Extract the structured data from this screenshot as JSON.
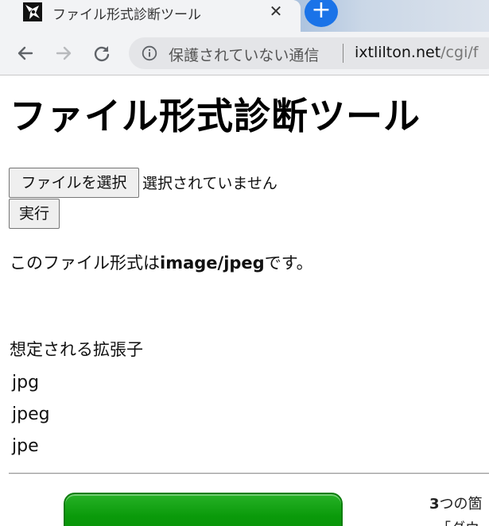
{
  "browser": {
    "tab_title": "ファイル形式診断ツール",
    "tab_close": "✕",
    "new_tab": "+",
    "security_label": "保護されていない通信",
    "url_host": "ixtlilton.net",
    "url_path": "/cgi/f"
  },
  "page": {
    "title": "ファイル形式診断ツール",
    "file_button_label": "ファイルを選択",
    "file_status": "選択されていません",
    "run_button_label": "実行",
    "result_prefix": "このファイル形式は",
    "mime_type": "image/jpeg",
    "result_suffix": "です。",
    "extensions_heading": "想定される拡張子",
    "extensions": [
      "jpg",
      "jpeg",
      "jpe"
    ],
    "side_text_bold": "3",
    "side_text_1": "つの箇",
    "side_text_2": "・「ダウ"
  },
  "colors": {
    "accent_blue": "#1a73e8",
    "banner_green": "#0a9a0a"
  }
}
